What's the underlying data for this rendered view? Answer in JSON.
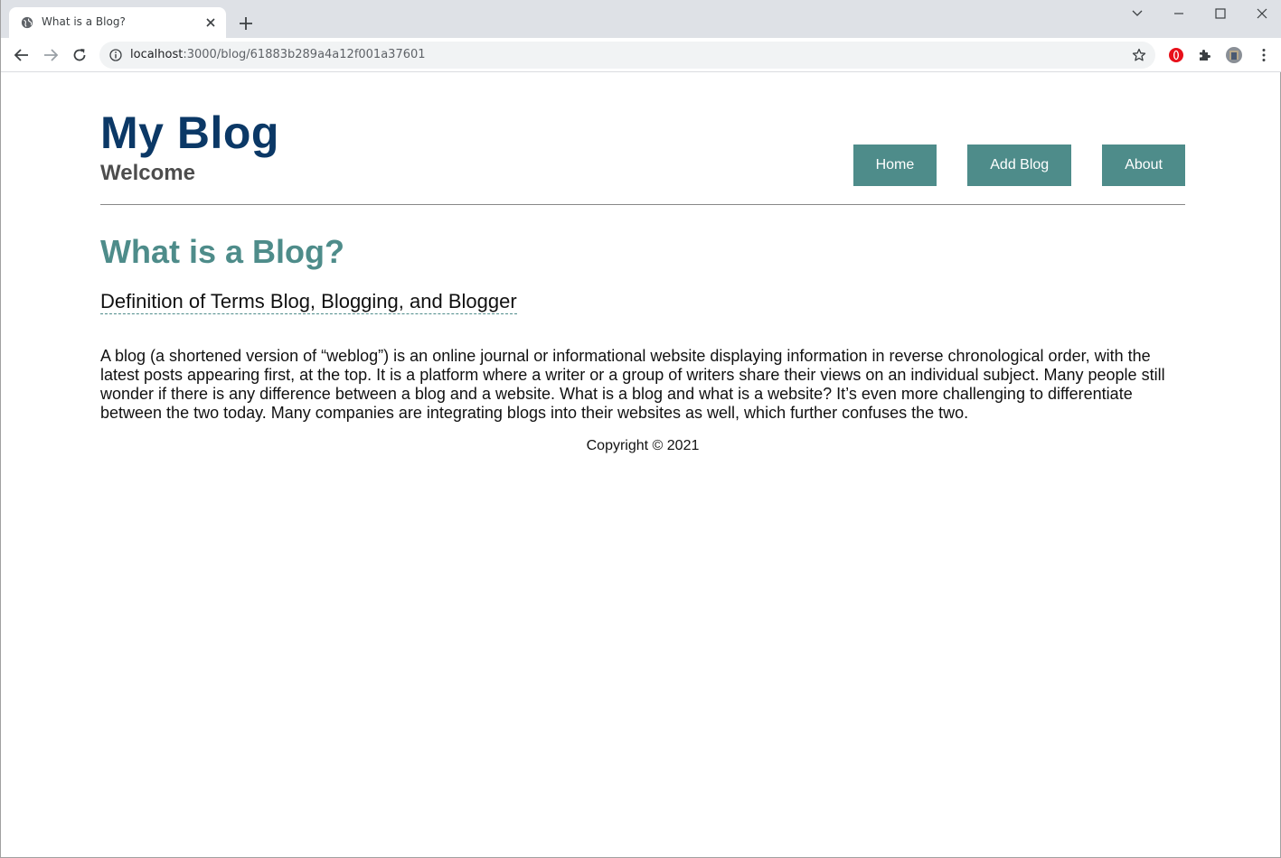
{
  "browser": {
    "tab_title": "What is a Blog?",
    "url_host": "localhost",
    "url_path": ":3000/blog/61883b289a4a12f001a37601"
  },
  "site": {
    "title": "My Blog",
    "subtitle": "Welcome",
    "nav": {
      "home": "Home",
      "add_blog": "Add Blog",
      "about": "About"
    }
  },
  "article": {
    "title": "What is a Blog?",
    "snippet": "Definition of Terms Blog, Blogging, and Blogger",
    "body": "A blog (a shortened version of “weblog”) is an online journal or informational website displaying information in reverse chronological order, with the latest posts appearing first, at the top. It is a platform where a writer or a group of writers share their views on an individual subject. Many people still wonder if there is any difference between a blog and a website. What is a blog and what is a website? It’s even more challenging to differentiate between the two today. Many companies are integrating blogs into their websites as well, which further confuses the two."
  },
  "footer": {
    "copyright": "Copyright © 2021"
  },
  "colors": {
    "site_title": "#0b3866",
    "accent": "#4e8c8a",
    "subtitle": "#4d4d4d"
  }
}
